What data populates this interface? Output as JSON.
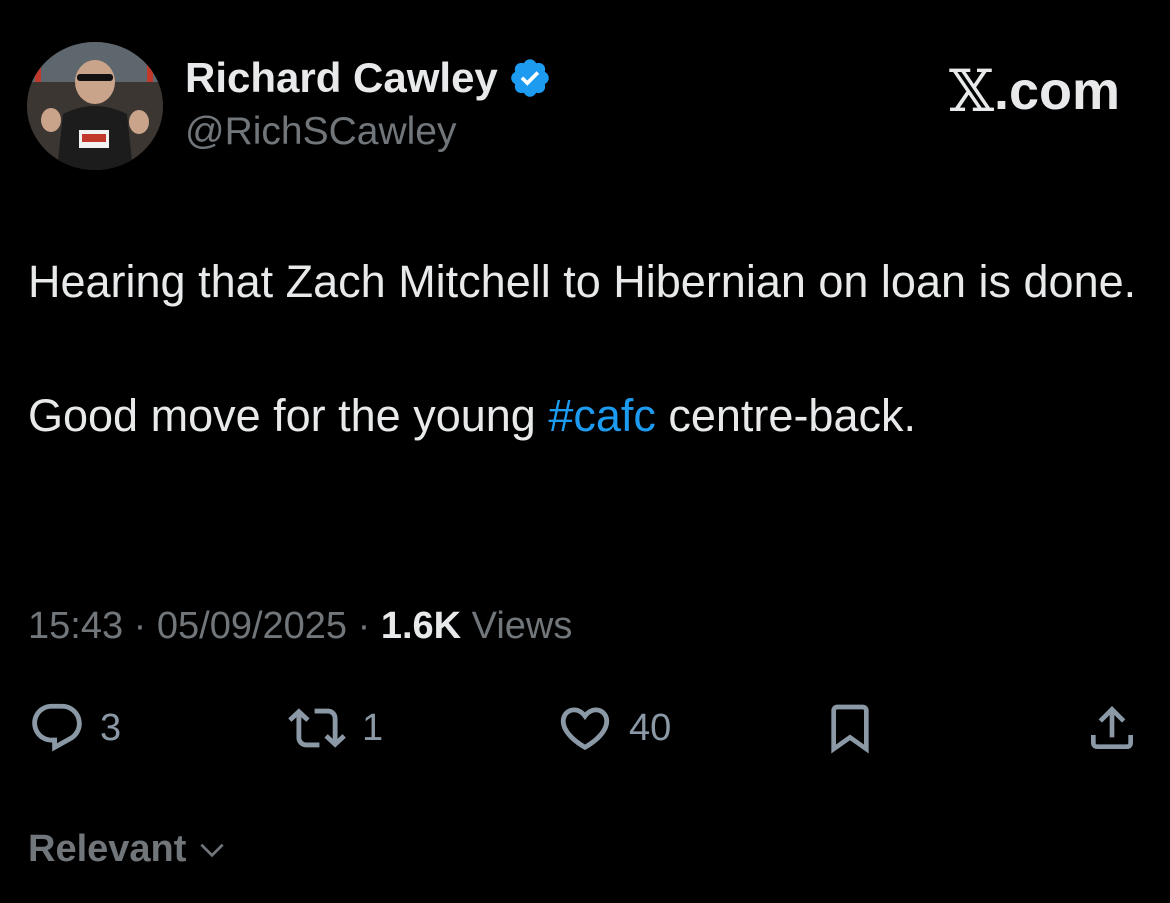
{
  "author": {
    "display_name": "Richard Cawley",
    "handle": "@RichSCawley",
    "verified": true,
    "avatar_icon": "runner-photo-avatar"
  },
  "site_label": {
    "x": "𝕏",
    "rest": ".com"
  },
  "tweet": {
    "line1": "Hearing that Zach Mitchell to Hibernian on loan is done.",
    "line2_prefix": "Good move for the young ",
    "hashtag": "#cafc",
    "line2_suffix": " centre-back."
  },
  "meta": {
    "time": "15:43",
    "sep1": " · ",
    "date": "05/09/2025",
    "sep2": " · ",
    "views_count": "1.6K",
    "views_label": " Views"
  },
  "actions": {
    "reply_count": "3",
    "repost_count": "1",
    "like_count": "40"
  },
  "sort": {
    "label": "Relevant"
  },
  "colors": {
    "background": "#000000",
    "text": "#e7e9ea",
    "secondary": "#71767b",
    "accent": "#1d9bf0"
  }
}
